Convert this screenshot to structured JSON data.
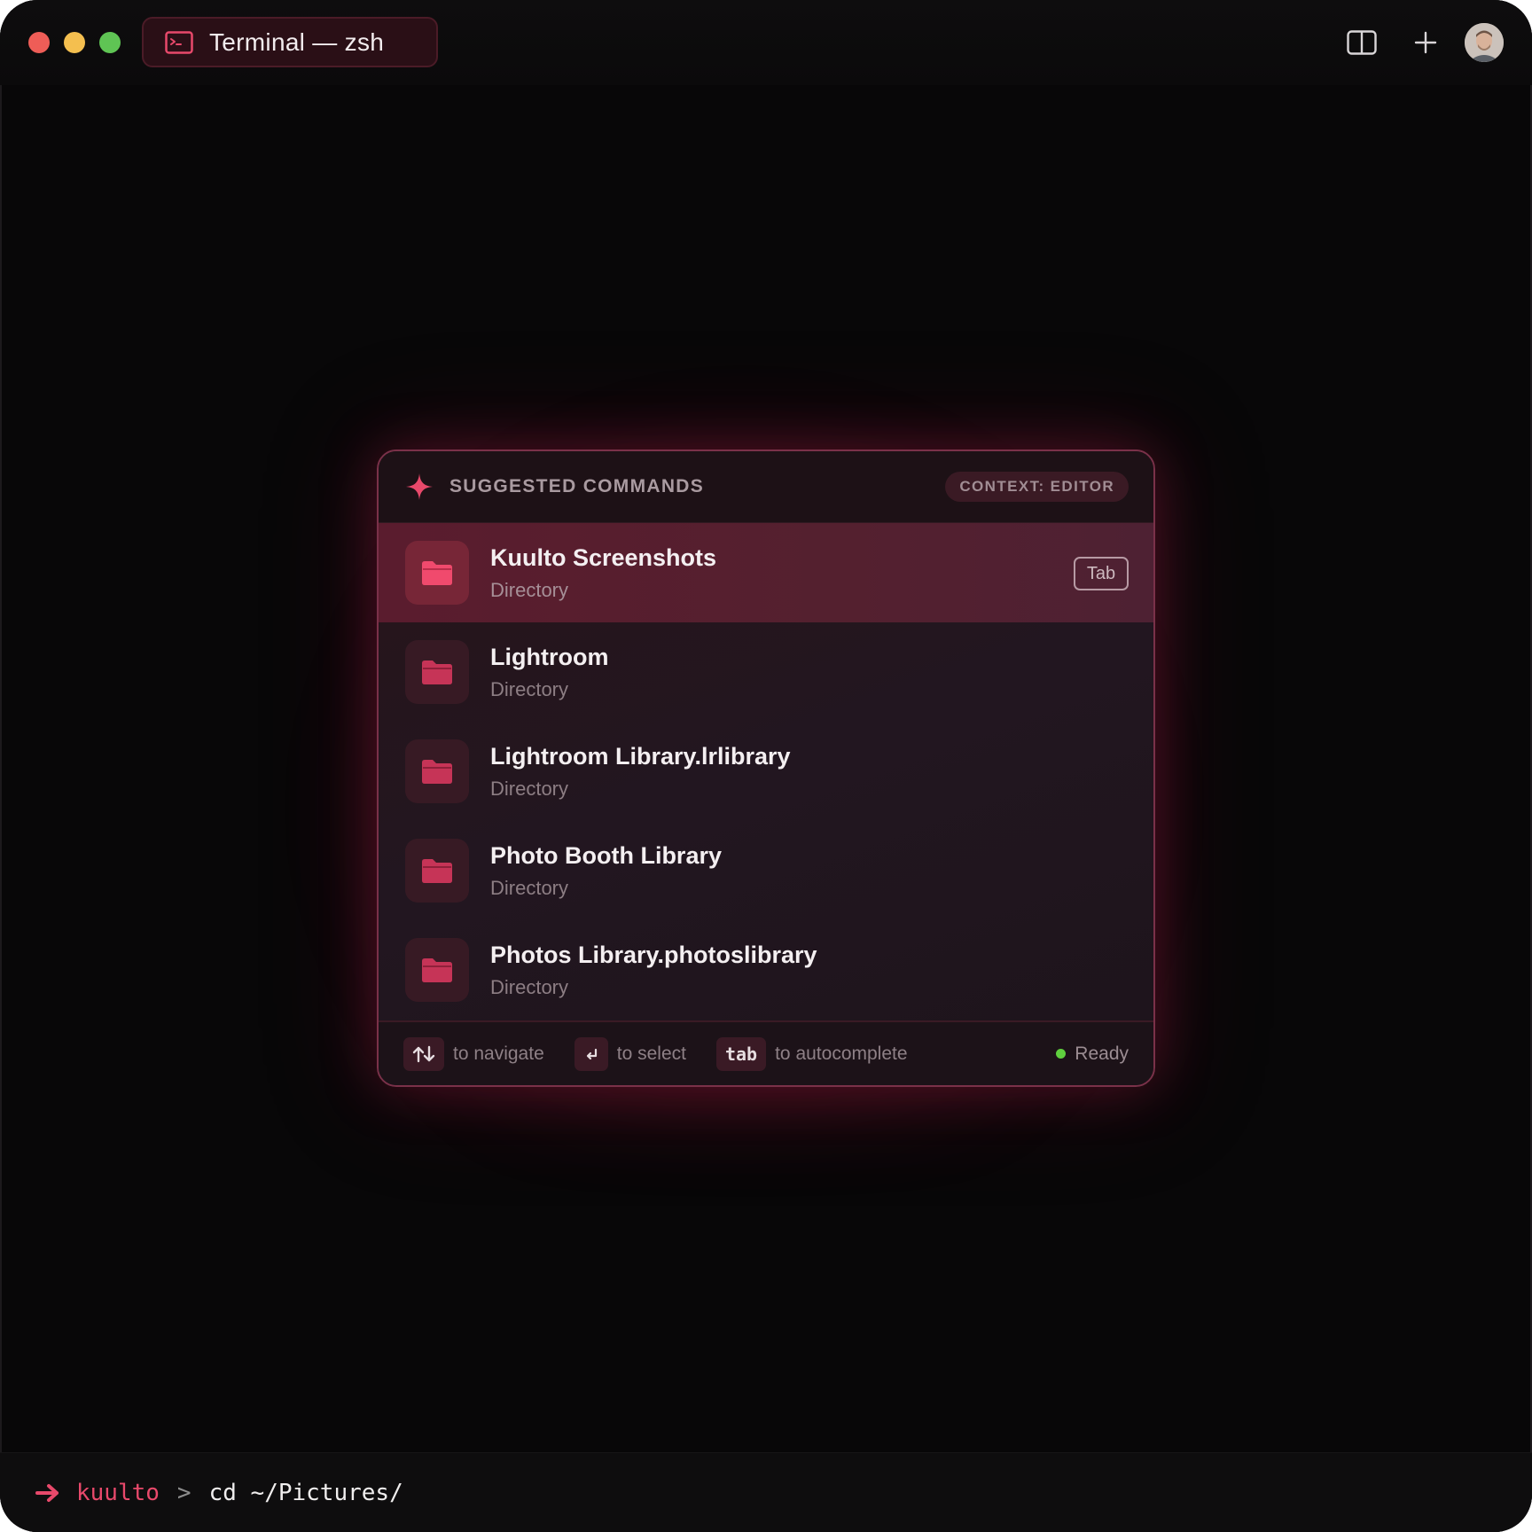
{
  "window": {
    "tab_title": "Terminal — zsh",
    "tab_icon": "terminal-icon",
    "titlebar_icons": [
      "split-view-icon",
      "plus-icon",
      "avatar"
    ]
  },
  "popup": {
    "header_icon": "sparkle-icon",
    "title": "SUGGESTED COMMANDS",
    "context_badge": "CONTEXT: EDITOR",
    "items": [
      {
        "title": "Kuulto Screenshots",
        "subtitle": "Directory",
        "icon": "folder-icon",
        "selected": true,
        "hint": "Tab"
      },
      {
        "title": "Lightroom",
        "subtitle": "Directory",
        "icon": "folder-icon"
      },
      {
        "title": "Lightroom Library.lrlibrary",
        "subtitle": "Directory",
        "icon": "folder-icon"
      },
      {
        "title": "Photo Booth Library",
        "subtitle": "Directory",
        "icon": "folder-icon"
      },
      {
        "title": "Photos Library.photoslibrary",
        "subtitle": "Directory",
        "icon": "folder-icon"
      }
    ],
    "footer": {
      "navigate_key_icon": "up-down-arrows-icon",
      "navigate_text": "to navigate",
      "select_key_icon": "return-icon",
      "select_text": "to select",
      "autocomplete_key": "tab",
      "autocomplete_text": "to autocomplete",
      "status": "Ready"
    }
  },
  "prompt": {
    "arrow_icon": "arrow-right-icon",
    "user": "kuulto",
    "separator": ">",
    "command": "cd ~/Pictures/"
  },
  "colors": {
    "accent": "#e8496b",
    "background": "#080708",
    "selected_row": "#5a1c2e",
    "status_ready": "#5fcf3e"
  }
}
